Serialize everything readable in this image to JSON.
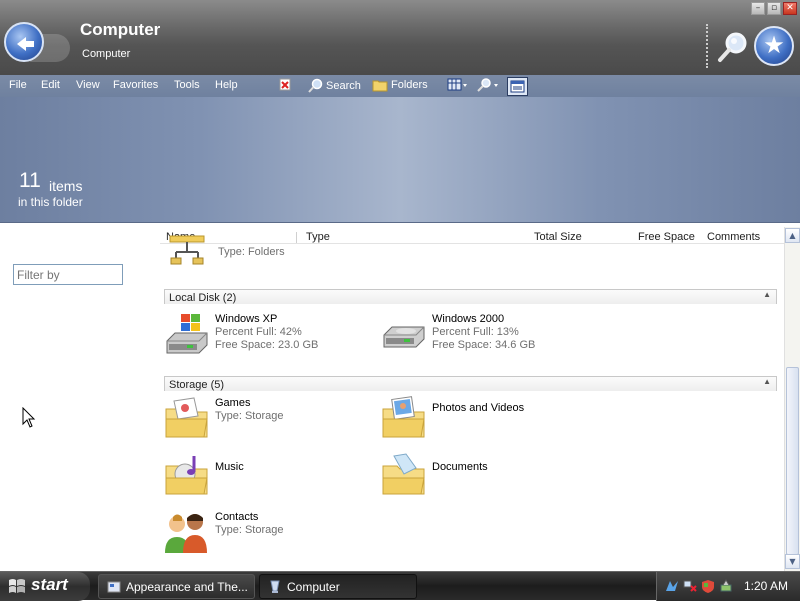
{
  "window": {
    "title": "Computer",
    "subtitle": "Computer"
  },
  "menubar": {
    "items": [
      "File",
      "Edit",
      "View",
      "Favorites",
      "Tools",
      "Help"
    ],
    "search_label": "Search",
    "folders_label": "Folders"
  },
  "banner": {
    "count": "11",
    "count_word": "items",
    "sub": "in this folder"
  },
  "left_pane": {
    "filter_placeholder": "Filter by"
  },
  "columns": [
    "Name",
    "Type",
    "Total Size",
    "Free Space",
    "Comments"
  ],
  "partial_item": {
    "sub": "Type: Folders",
    "icon": "network-folder-icon"
  },
  "groups": [
    {
      "label": "Local Disk (2)",
      "items": [
        {
          "name": "Windows XP",
          "line1": "Percent Full: 42%",
          "line2": "Free Space: 23.0 GB",
          "icon": "windows-drive-icon",
          "percent_full": 42
        },
        {
          "name": "Windows 2000",
          "line1": "Percent Full: 13%",
          "line2": "Free Space: 34.6 GB",
          "icon": "hard-drive-icon",
          "percent_full": 13
        }
      ]
    },
    {
      "label": "Storage (5)",
      "items": [
        {
          "name": "Games",
          "line1": "Type: Storage",
          "icon": "games-folder-icon"
        },
        {
          "name": "Photos and Videos",
          "icon": "photos-folder-icon"
        },
        {
          "name": "Music",
          "icon": "music-folder-icon"
        },
        {
          "name": "Documents",
          "icon": "documents-folder-icon"
        },
        {
          "name": "Contacts",
          "line1": "Type: Storage",
          "icon": "contacts-icon"
        }
      ]
    }
  ],
  "taskbar": {
    "start_label": "start",
    "tasks": [
      {
        "label": "Appearance and The...",
        "active": false
      },
      {
        "label": "Computer",
        "active": true
      }
    ],
    "clock": "1:20 AM"
  },
  "colors": {
    "banner": "#8092b2",
    "menubar": "#7b8ba6",
    "titlebar": "#6a6a6a",
    "accent_blue": "#3f6fc4"
  }
}
